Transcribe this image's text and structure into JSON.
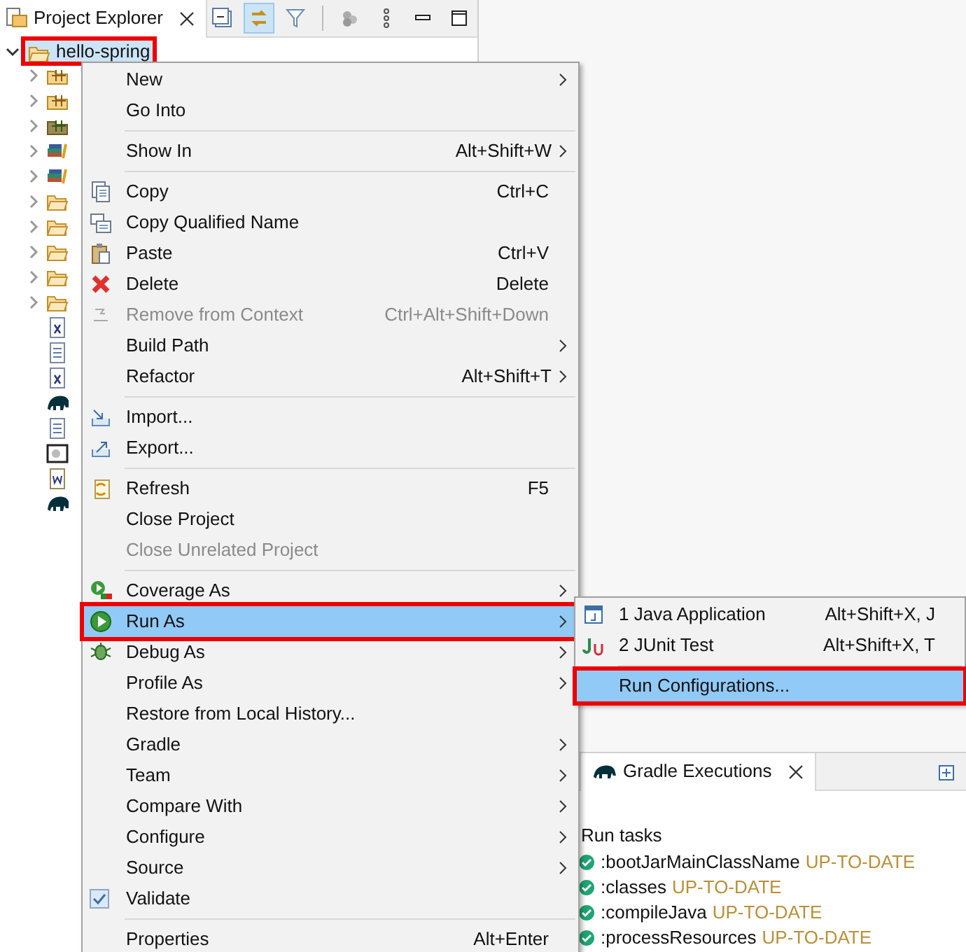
{
  "explorer": {
    "title": "Project Explorer",
    "toolbar": [
      {
        "kind": "collapse",
        "selected": false
      },
      {
        "kind": "link",
        "selected": true
      },
      {
        "kind": "filter",
        "selected": false
      },
      {
        "kind": "disks",
        "selected": false
      },
      {
        "kind": "more",
        "selected": false
      },
      {
        "kind": "minimize",
        "selected": false
      },
      {
        "kind": "maximize",
        "selected": false
      }
    ],
    "root": {
      "label": "hello-spring",
      "expanded": true,
      "highlighted": true,
      "children": [
        {
          "kind": "package",
          "expandable": true
        },
        {
          "kind": "package",
          "expandable": true
        },
        {
          "kind": "package-dark",
          "expandable": true
        },
        {
          "kind": "library",
          "expandable": true
        },
        {
          "kind": "library",
          "expandable": true
        },
        {
          "kind": "folder",
          "expandable": true
        },
        {
          "kind": "folder",
          "expandable": true
        },
        {
          "kind": "folder",
          "expandable": true
        },
        {
          "kind": "folder",
          "expandable": true
        },
        {
          "kind": "folder",
          "expandable": true
        },
        {
          "kind": "xml",
          "expandable": false
        },
        {
          "kind": "doc",
          "expandable": false
        },
        {
          "kind": "xml",
          "expandable": false
        },
        {
          "kind": "gradle",
          "expandable": false
        },
        {
          "kind": "doc",
          "expandable": false
        },
        {
          "kind": "image",
          "expandable": false
        },
        {
          "kind": "word",
          "expandable": false
        },
        {
          "kind": "gradle",
          "expandable": false
        }
      ]
    }
  },
  "context_menu": {
    "groups": [
      [
        {
          "label": "New",
          "submenu": true
        },
        {
          "label": "Go Into"
        }
      ],
      [
        {
          "label": "Show In",
          "shortcut": "Alt+Shift+W",
          "submenu": true
        }
      ],
      [
        {
          "label": "Copy",
          "shortcut": "Ctrl+C",
          "kind": "copy"
        },
        {
          "label": "Copy Qualified Name",
          "kind": "copy-qualified"
        },
        {
          "label": "Paste",
          "shortcut": "Ctrl+V",
          "kind": "paste"
        },
        {
          "label": "Delete",
          "shortcut": "Delete",
          "kind": "delete"
        },
        {
          "label": "Remove from Context",
          "shortcut": "Ctrl+Alt+Shift+Down",
          "kind": "remove",
          "disabled": true
        },
        {
          "label": "Build Path",
          "submenu": true
        },
        {
          "label": "Refactor",
          "shortcut": "Alt+Shift+T",
          "submenu": true
        }
      ],
      [
        {
          "label": "Import...",
          "kind": "import"
        },
        {
          "label": "Export...",
          "kind": "export"
        }
      ],
      [
        {
          "label": "Refresh",
          "shortcut": "F5",
          "kind": "refresh"
        },
        {
          "label": "Close Project"
        },
        {
          "label": "Close Unrelated Project",
          "disabled": true
        }
      ],
      [
        {
          "label": "Coverage As",
          "submenu": true,
          "kind": "coverage"
        },
        {
          "label": "Run As",
          "submenu": true,
          "kind": "run",
          "selected": true,
          "highlighted": true
        },
        {
          "label": "Debug As",
          "submenu": true,
          "kind": "debug"
        },
        {
          "label": "Profile As",
          "submenu": true
        },
        {
          "label": "Restore from Local History..."
        },
        {
          "label": "Gradle",
          "submenu": true
        },
        {
          "label": "Team",
          "submenu": true
        },
        {
          "label": "Compare With",
          "submenu": true
        },
        {
          "label": "Configure",
          "submenu": true
        },
        {
          "label": "Source",
          "submenu": true
        },
        {
          "label": "Validate",
          "checked": true
        }
      ],
      [
        {
          "label": "Properties",
          "shortcut": "Alt+Enter"
        }
      ]
    ]
  },
  "run_as_submenu": {
    "groups": [
      [
        {
          "label": "1 Java Application",
          "shortcut": "Alt+Shift+X, J",
          "kind": "java-app"
        },
        {
          "label": "2 JUnit Test",
          "shortcut": "Alt+Shift+X, T",
          "kind": "junit"
        }
      ],
      [
        {
          "label": "Run Configurations...",
          "selected": true,
          "highlighted": true
        }
      ]
    ]
  },
  "gradle_executions": {
    "tab": "Gradle Executions",
    "heading": "Run tasks",
    "tasks": [
      {
        "name": ":bootJarMainClassName",
        "status": "UP-TO-DATE"
      },
      {
        "name": ":classes",
        "status": "UP-TO-DATE"
      },
      {
        "name": ":compileJava",
        "status": "UP-TO-DATE"
      },
      {
        "name": ":processResources",
        "status": "UP-TO-DATE"
      }
    ]
  }
}
